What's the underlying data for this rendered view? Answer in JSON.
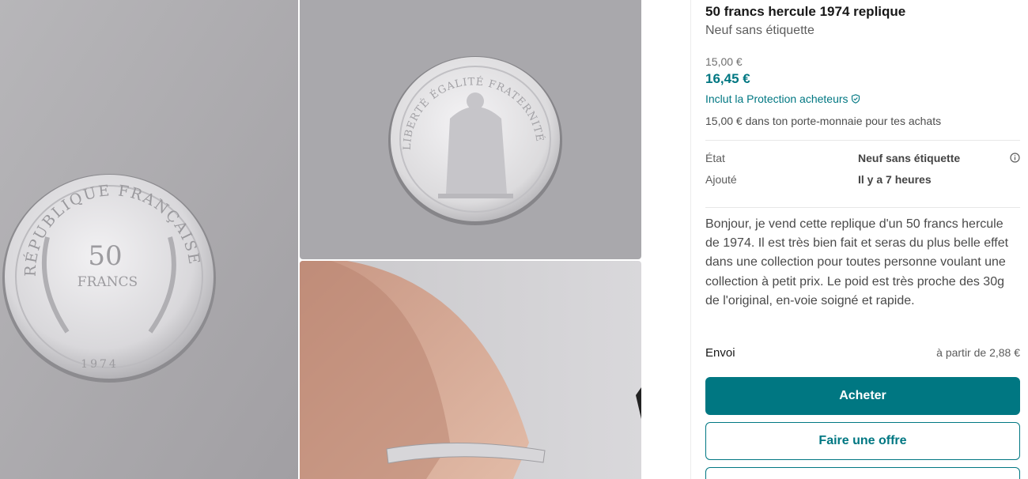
{
  "item": {
    "title": "50 francs hercule 1974 replique",
    "condition_subtitle": "Neuf sans étiquette",
    "price_original": "15,00 €",
    "price_total": "16,45 €",
    "protection_label": "Inclut la Protection acheteurs",
    "wallet_note": "15,00 € dans ton porte-monnaie pour tes achats"
  },
  "details": [
    {
      "label": "État",
      "value": "Neuf sans étiquette"
    },
    {
      "label": "Ajouté",
      "value": "Il y a 7 heures"
    }
  ],
  "description": "Bonjour, je vend cette replique d'un 50 francs hercule de 1974. Il est très bien fait et seras du plus belle effet dans une collection pour toutes personne voulant une collection à petit prix. Le poid est très proche des 30g de l'original, en-voie soigné et rapide.",
  "shipping": {
    "label": "Envoi",
    "value": "à partir de 2,88 €"
  },
  "actions": {
    "buy_label": "Acheter",
    "offer_label": "Faire une offre"
  },
  "coin": {
    "face1_top_arc": "RÉPUBLIQUE FRANÇAISE",
    "face1_value": "50",
    "face1_unit": "FRANCS",
    "face1_year": "1974",
    "face2_motto": "LIBERTÉ ÉGALITÉ FRATERNITÉ"
  },
  "colors": {
    "accent": "#007782",
    "background": "#ffffff"
  },
  "icons": {
    "protection": "shield-check-icon",
    "info": "info-circle-icon"
  }
}
